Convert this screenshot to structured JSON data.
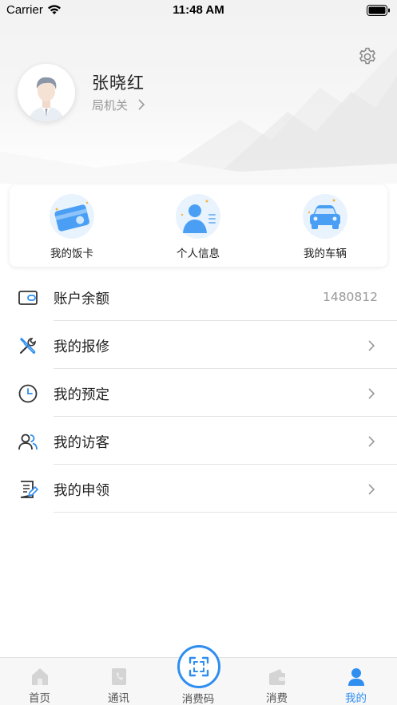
{
  "status_bar": {
    "carrier": "Carrier",
    "time": "11:48 AM"
  },
  "profile": {
    "name": "张晓红",
    "department": "局机关"
  },
  "quick_actions": [
    {
      "label": "我的饭卡",
      "icon": "meal-card-icon"
    },
    {
      "label": "个人信息",
      "icon": "personal-info-icon"
    },
    {
      "label": "我的车辆",
      "icon": "car-icon"
    }
  ],
  "menu": {
    "balance": {
      "label": "账户余额",
      "value": "1480812",
      "icon": "wallet-icon"
    },
    "repair": {
      "label": "我的报修",
      "icon": "tools-icon"
    },
    "booking": {
      "label": "我的预定",
      "icon": "clock-icon"
    },
    "visitors": {
      "label": "我的访客",
      "icon": "people-icon"
    },
    "requisition": {
      "label": "我的申领",
      "icon": "document-icon"
    }
  },
  "tabbar": {
    "home": "首页",
    "contacts": "通讯",
    "pay_code": "消费码",
    "consumption": "消费",
    "mine": "我的"
  },
  "colors": {
    "accent": "#2f8ef0",
    "icon_light": "#4a9ff5"
  }
}
